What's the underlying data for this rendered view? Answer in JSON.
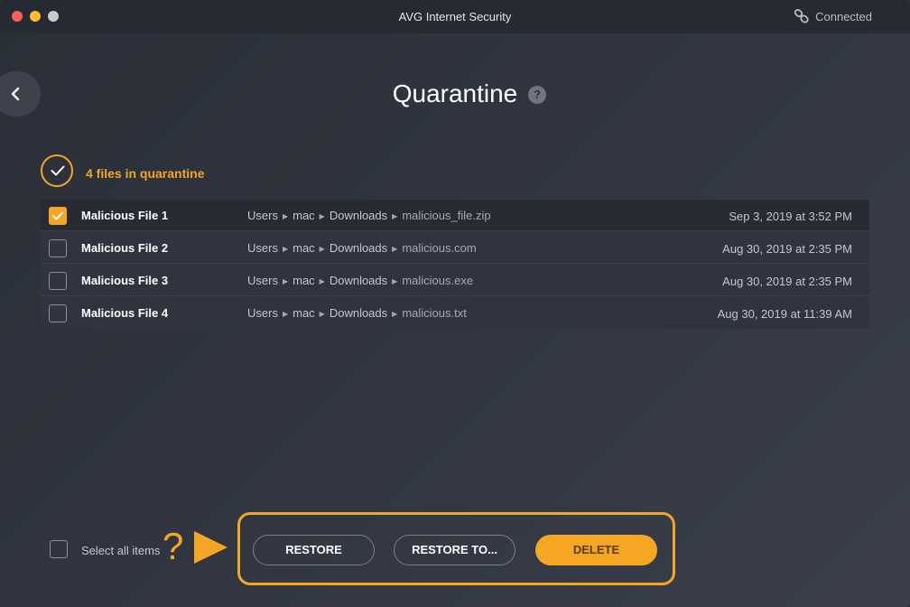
{
  "window": {
    "title": "AVG Internet Security",
    "connection_status": "Connected"
  },
  "page": {
    "title": "Quarantine",
    "help": "?"
  },
  "summary": {
    "text": "4 files in quarantine"
  },
  "files": [
    {
      "name": "Malicious File 1",
      "path": [
        "Users",
        "mac",
        "Downloads"
      ],
      "filename": "malicious_file.zip",
      "date": "Sep 3, 2019 at 3:52 PM",
      "checked": true
    },
    {
      "name": "Malicious File 2",
      "path": [
        "Users",
        "mac",
        "Downloads"
      ],
      "filename": "malicious.com",
      "date": "Aug 30, 2019 at 2:35 PM",
      "checked": false
    },
    {
      "name": "Malicious File 3",
      "path": [
        "Users",
        "mac",
        "Downloads"
      ],
      "filename": "malicious.exe",
      "date": "Aug 30, 2019 at 2:35 PM",
      "checked": false
    },
    {
      "name": "Malicious File 4",
      "path": [
        "Users",
        "mac",
        "Downloads"
      ],
      "filename": "malicious.txt",
      "date": "Aug 30, 2019 at 11:39 AM",
      "checked": false
    }
  ],
  "footer": {
    "select_all_label": "Select all items",
    "annotation_mark": "?",
    "restore_label": "RESTORE",
    "restore_to_label": "RESTORE TO...",
    "delete_label": "DELETE"
  },
  "colors": {
    "accent": "#f5a623",
    "background": "#2f343e"
  },
  "icons": [
    "chain-link-icon",
    "back-chevron-icon",
    "help-icon",
    "checkmark-icon",
    "arrow-right-icon"
  ]
}
